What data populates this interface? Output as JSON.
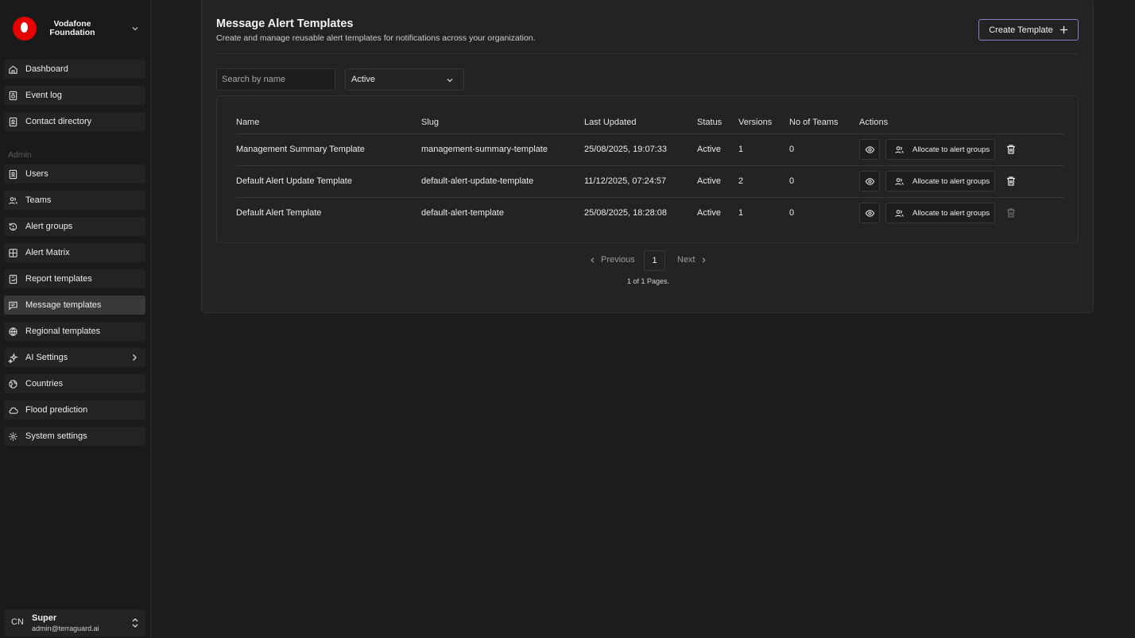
{
  "brand": {
    "name": "Vodafone Foundation"
  },
  "sidebar": {
    "items": [
      {
        "label": "Dashboard",
        "icon": "home-icon"
      },
      {
        "label": "Event log",
        "icon": "event-log-icon"
      },
      {
        "label": "Contact directory",
        "icon": "contact-book-icon"
      }
    ],
    "admin_label": "Admin",
    "admin_items": [
      {
        "label": "Users",
        "icon": "user-badge-icon"
      },
      {
        "label": "Teams",
        "icon": "users-icon"
      },
      {
        "label": "Alert groups",
        "icon": "alert-history-icon"
      },
      {
        "label": "Alert Matrix",
        "icon": "grid-icon"
      },
      {
        "label": "Report templates",
        "icon": "report-icon"
      },
      {
        "label": "Message templates",
        "icon": "message-icon",
        "active": true
      },
      {
        "label": "Regional templates",
        "icon": "globe-icon"
      },
      {
        "label": "AI Settings",
        "icon": "sparkle-icon"
      },
      {
        "label": "Countries",
        "icon": "earth-icon"
      },
      {
        "label": "Flood prediction",
        "icon": "cloud-icon"
      },
      {
        "label": "System settings",
        "icon": "gear-icon"
      }
    ]
  },
  "user": {
    "initials": "CN",
    "name": "Super",
    "email": "admin@terraguard.ai"
  },
  "page": {
    "title": "Message Alert Templates",
    "subtitle": "Create and manage reusable alert templates for notifications across your organization.",
    "create_label": "Create Template"
  },
  "filters": {
    "search_placeholder": "Search by name",
    "status_value": "Active"
  },
  "table": {
    "headers": [
      "Name",
      "Slug",
      "Last Updated",
      "Status",
      "Versions",
      "No of Teams",
      "Actions"
    ],
    "allocate_label": "Allocate to alert groups",
    "rows": [
      {
        "name": "Management Summary Template",
        "slug": "management-summary-template",
        "updated": "25/08/2025, 19:07:33",
        "status": "Active",
        "versions": "1",
        "teams": "0"
      },
      {
        "name": "Default Alert Update Template",
        "slug": "default-alert-update-template",
        "updated": "11/12/2025, 07:24:57",
        "status": "Active",
        "versions": "2",
        "teams": "0"
      },
      {
        "name": "Default Alert Template",
        "slug": "default-alert-template",
        "updated": "25/08/2025, 18:28:08",
        "status": "Active",
        "versions": "1",
        "teams": "0"
      }
    ]
  },
  "pagination": {
    "prev_label": "Previous",
    "current": "1",
    "next_label": "Next",
    "info": "1 of 1 Pages."
  },
  "colors": {
    "background": "#1f1d1d",
    "card": "#242222",
    "brand_red": "#e60000",
    "accent_border": "#8b7fc4"
  }
}
